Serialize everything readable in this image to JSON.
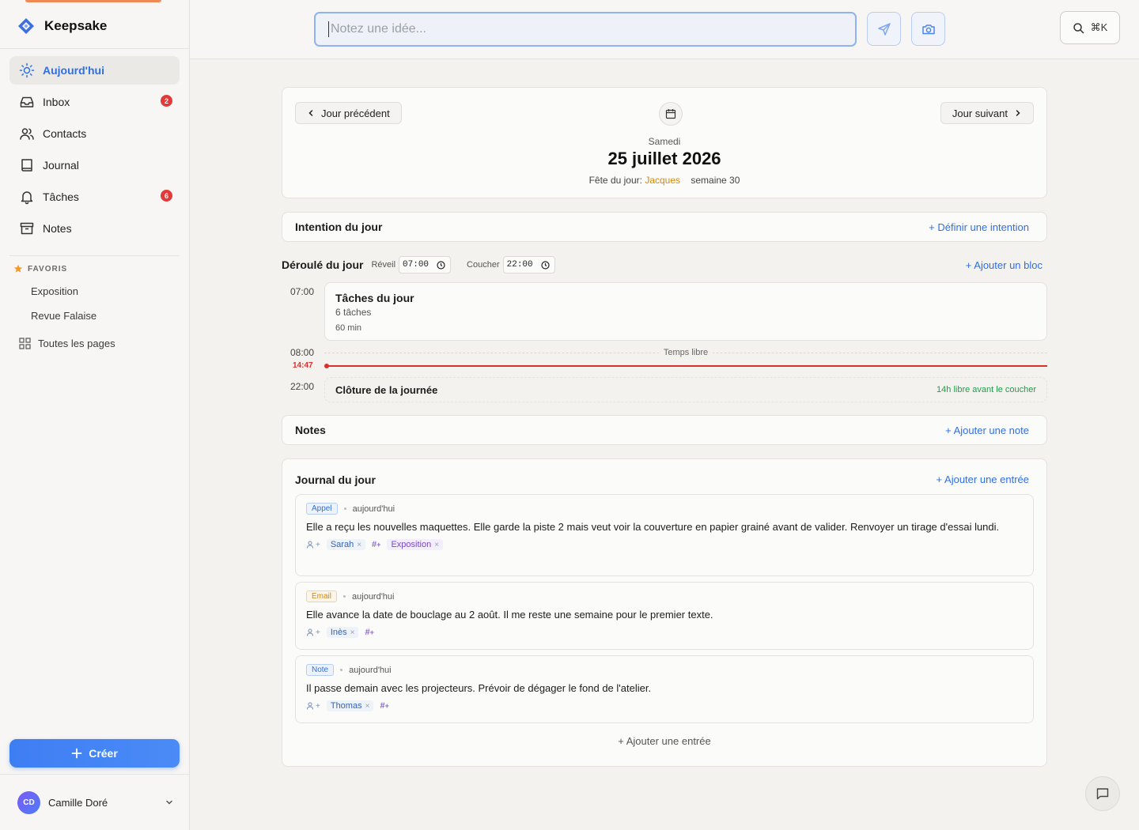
{
  "app": {
    "name": "Keepsake"
  },
  "sidebar": {
    "items": [
      {
        "label": "Aujourd'hui",
        "icon": "sun-icon",
        "active": true
      },
      {
        "label": "Inbox",
        "icon": "inbox-icon",
        "badge": "2"
      },
      {
        "label": "Contacts",
        "icon": "users-icon"
      },
      {
        "label": "Journal",
        "icon": "book-icon"
      },
      {
        "label": "Tâches",
        "icon": "bell-icon",
        "badge": "6"
      },
      {
        "label": "Notes",
        "icon": "archive-icon"
      }
    ],
    "favorites_label": "FAVORIS",
    "favorites": [
      "Exposition",
      "Revue Falaise"
    ],
    "all_pages": "Toutes les pages",
    "create_label": "Créer",
    "user": {
      "initials": "CD",
      "name": "Camille Doré"
    }
  },
  "topbar": {
    "quick_placeholder": "Notez une idée...",
    "search_shortcut": "⌘K"
  },
  "day": {
    "prev_label": "Jour précédent",
    "next_label": "Jour suivant",
    "weekday": "Samedi",
    "date": "25 juillet 2026",
    "saint_prefix": "Fête du jour:",
    "saint": "Jacques",
    "week": "semaine 30"
  },
  "intention": {
    "title": "Intention du jour",
    "action": "+ Définir une intention"
  },
  "schedule": {
    "title": "Déroulé du jour",
    "wake_label": "Réveil",
    "wake_time": "07:00",
    "sleep_label": "Coucher",
    "sleep_time": "22:00",
    "add_block": "+ Ajouter un bloc",
    "blocks": [
      {
        "time": "07:00",
        "title": "Tâches du jour",
        "subtitle": "6 tâches",
        "duration": "60 min"
      }
    ],
    "free_time": {
      "time": "08:00",
      "label": "Temps libre"
    },
    "now": "14:47",
    "closing": {
      "time": "22:00",
      "title": "Clôture de la journée",
      "free_note": "14h libre avant le coucher"
    }
  },
  "notes": {
    "title": "Notes",
    "action": "+ Ajouter une note"
  },
  "journal": {
    "title": "Journal du jour",
    "action": "+ Ajouter une entrée",
    "entries": [
      {
        "type": "Appel",
        "when": "aujourd'hui",
        "text": "Elle a reçu les nouvelles maquettes. Elle garde la piste 2 mais veut voir la couverture en papier grainé avant de valider. Renvoyer un tirage d'essai lundi.",
        "person": "Sarah",
        "topic": "Exposition"
      },
      {
        "type": "Email",
        "when": "aujourd'hui",
        "text": "Elle avance la date de bouclage au 2 août. Il me reste une semaine pour le premier texte.",
        "person": "Inès"
      },
      {
        "type": "Note",
        "when": "aujourd'hui",
        "text": "Il passe demain avec les projecteurs. Prévoir de dégager le fond de l'atelier.",
        "person": "Thomas"
      }
    ],
    "add_bottom": "+ Ajouter une entrée"
  },
  "colors": {
    "accent": "#2f6fe4",
    "danger": "#d9302c",
    "success": "#1e9e46",
    "saint": "#d6880a"
  }
}
